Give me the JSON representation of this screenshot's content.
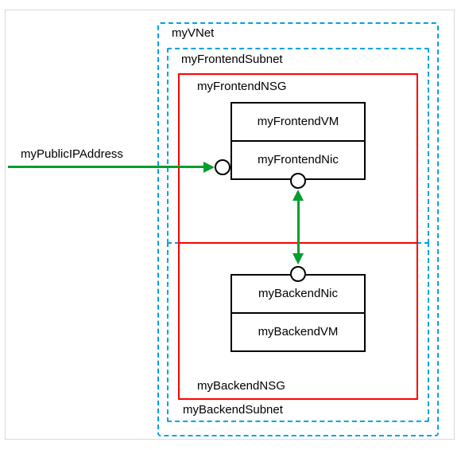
{
  "vnet": {
    "label": "myVNet"
  },
  "subnets": {
    "frontend": {
      "label": "myFrontendSubnet"
    },
    "backend": {
      "label": "myBackendSubnet"
    }
  },
  "nsgs": {
    "frontend": {
      "label": "myFrontendNSG"
    },
    "backend": {
      "label": "myBackendNSG"
    }
  },
  "components": {
    "frontend_vm": {
      "label": "myFrontendVM"
    },
    "frontend_nic": {
      "label": "myFrontendNic"
    },
    "backend_nic": {
      "label": "myBackendNic"
    },
    "backend_vm": {
      "label": "myBackendVM"
    }
  },
  "external": {
    "public_ip": {
      "label": "myPublicIPAddress"
    }
  },
  "colors": {
    "subnet_border": "#00a2e8",
    "nsg_border": "#ff0000",
    "arrow": "#009e2f"
  }
}
